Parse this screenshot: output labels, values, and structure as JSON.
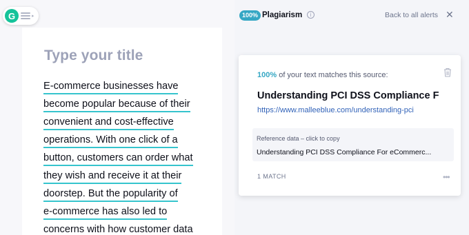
{
  "editor": {
    "title_placeholder": "Type your title",
    "lines": [
      "E-commerce businesses have",
      "become popular because of their",
      "convenient and cost-effective",
      "operations. With one click of a",
      "button, customers can order what",
      "they wish and receive it at their",
      "doorstep. But the popularity of",
      "e-commerce has also led to",
      "concerns with how customer data"
    ],
    "underline_color": "#35c4cd"
  },
  "grammarly_button": {
    "logo_letter": "G",
    "icon": "grammarly-logo-icon",
    "menu_icon": "hamburger-menu-icon"
  },
  "header": {
    "badge": "100%",
    "title": "Plagiarism",
    "info_icon": "info-icon",
    "back_label": "Back to all alerts",
    "close_icon": "close-icon"
  },
  "alert_card": {
    "match_percent": "100%",
    "match_text": " of your text matches this source:",
    "trash_icon": "trash-icon",
    "source_title": "Understanding PCI DSS Compliance F",
    "source_url": "https://www.malleeblue.com/understanding-pci",
    "reference_label": "Reference data – click to copy",
    "reference_value": "Understanding PCI DSS Compliance For eCommerc...",
    "match_count": "1 MATCH",
    "more_icon": "more-options-icon"
  },
  "colors": {
    "accent": "#35a7c4",
    "brand_green": "#15c39a",
    "link": "#3162b8"
  }
}
